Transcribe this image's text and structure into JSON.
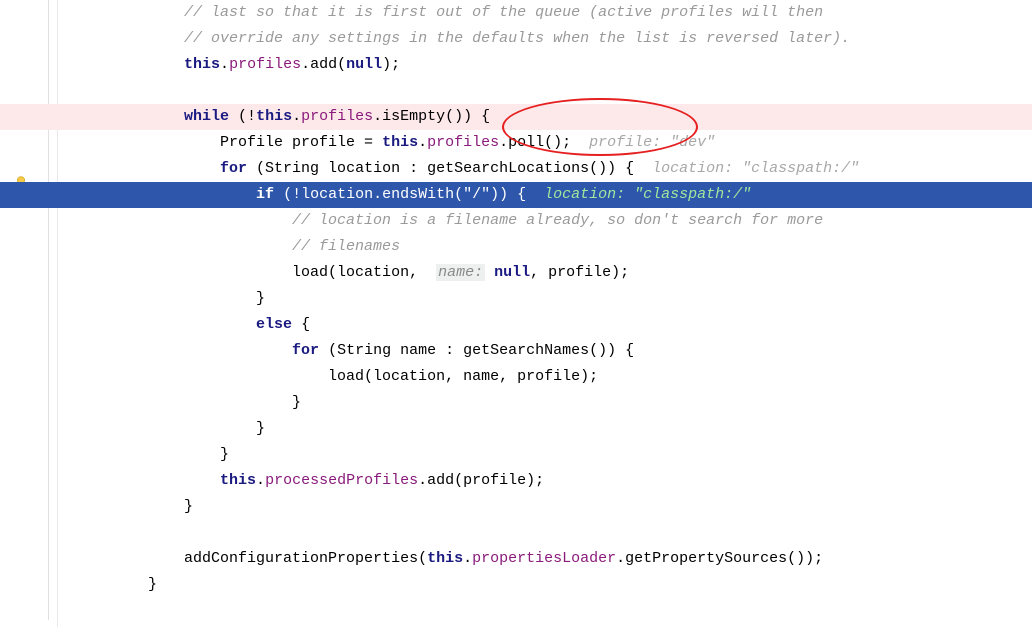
{
  "gutter": {
    "bulb_visible": true
  },
  "lines": [
    {
      "indent": 3,
      "segments": [
        {
          "t": "cmt",
          "v": "// last so that it is first out of the queue (active profiles will then"
        }
      ]
    },
    {
      "indent": 3,
      "segments": [
        {
          "t": "cmt",
          "v": "// override any settings in the defaults when the list is reversed later)."
        }
      ]
    },
    {
      "indent": 3,
      "segments": [
        {
          "t": "kw",
          "v": "this"
        },
        {
          "t": "p",
          "v": "."
        },
        {
          "t": "field",
          "v": "profiles"
        },
        {
          "t": "p",
          "v": ".add("
        },
        {
          "t": "kw",
          "v": "null"
        },
        {
          "t": "p",
          "v": ");"
        }
      ]
    },
    {
      "indent": 3,
      "segments": []
    },
    {
      "indent": 3,
      "class": "hl-pink",
      "segments": [
        {
          "t": "kw",
          "v": "while"
        },
        {
          "t": "p",
          "v": " (!"
        },
        {
          "t": "kw",
          "v": "this"
        },
        {
          "t": "p",
          "v": "."
        },
        {
          "t": "field",
          "v": "profiles"
        },
        {
          "t": "p",
          "v": ".isEmpty()) {"
        }
      ]
    },
    {
      "indent": 4,
      "segments": [
        {
          "t": "p",
          "v": "Profile profile = "
        },
        {
          "t": "kw",
          "v": "this"
        },
        {
          "t": "p",
          "v": "."
        },
        {
          "t": "field",
          "v": "profiles"
        },
        {
          "t": "p",
          "v": ".poll();  "
        },
        {
          "t": "hint",
          "v": "profile: \"dev\""
        }
      ]
    },
    {
      "indent": 4,
      "segments": [
        {
          "t": "kw",
          "v": "for"
        },
        {
          "t": "p",
          "v": " (String location : getSearchLocations()) {  "
        },
        {
          "t": "hint",
          "v": "location: \"classpath:/\""
        }
      ]
    },
    {
      "indent": 5,
      "class": "hl-blue",
      "segments": [
        {
          "t": "kw",
          "v": "if"
        },
        {
          "t": "p",
          "v": " (!location.endsWith("
        },
        {
          "t": "str",
          "v": "\"/\""
        },
        {
          "t": "p",
          "v": ")) {  "
        },
        {
          "t": "hint",
          "v": "location: \"classpath:/\""
        }
      ]
    },
    {
      "indent": 6,
      "segments": [
        {
          "t": "cmt",
          "v": "// location is a filename already, so don't search for more"
        }
      ]
    },
    {
      "indent": 6,
      "segments": [
        {
          "t": "cmt",
          "v": "// filenames"
        }
      ]
    },
    {
      "indent": 6,
      "segments": [
        {
          "t": "p",
          "v": "load(location,  "
        },
        {
          "t": "hint-name",
          "v": "name:"
        },
        {
          "t": "p",
          "v": " "
        },
        {
          "t": "kw",
          "v": "null"
        },
        {
          "t": "p",
          "v": ", profile);"
        }
      ]
    },
    {
      "indent": 5,
      "segments": [
        {
          "t": "p",
          "v": "}"
        }
      ]
    },
    {
      "indent": 5,
      "segments": [
        {
          "t": "kw",
          "v": "else"
        },
        {
          "t": "p",
          "v": " {"
        }
      ]
    },
    {
      "indent": 6,
      "segments": [
        {
          "t": "kw",
          "v": "for"
        },
        {
          "t": "p",
          "v": " (String name : getSearchNames()) {"
        }
      ]
    },
    {
      "indent": 7,
      "segments": [
        {
          "t": "p",
          "v": "load(location, name, profile);"
        }
      ]
    },
    {
      "indent": 6,
      "segments": [
        {
          "t": "p",
          "v": "}"
        }
      ]
    },
    {
      "indent": 5,
      "segments": [
        {
          "t": "p",
          "v": "}"
        }
      ]
    },
    {
      "indent": 4,
      "segments": [
        {
          "t": "p",
          "v": "}"
        }
      ]
    },
    {
      "indent": 4,
      "segments": [
        {
          "t": "kw",
          "v": "this"
        },
        {
          "t": "p",
          "v": "."
        },
        {
          "t": "field",
          "v": "processedProfiles"
        },
        {
          "t": "p",
          "v": ".add(profile);"
        }
      ]
    },
    {
      "indent": 3,
      "segments": [
        {
          "t": "p",
          "v": "}"
        }
      ]
    },
    {
      "indent": 3,
      "segments": []
    },
    {
      "indent": 3,
      "segments": [
        {
          "t": "p",
          "v": "addConfigurationProperties("
        },
        {
          "t": "kw",
          "v": "this"
        },
        {
          "t": "p",
          "v": "."
        },
        {
          "t": "field",
          "v": "propertiesLoader"
        },
        {
          "t": "p",
          "v": ".getPropertySources());"
        }
      ]
    },
    {
      "indent": 2,
      "segments": [
        {
          "t": "p",
          "v": "}"
        }
      ]
    },
    {
      "indent": 2,
      "segments": []
    }
  ],
  "annotations": {
    "ellipse_target": "profile: \"dev\""
  }
}
